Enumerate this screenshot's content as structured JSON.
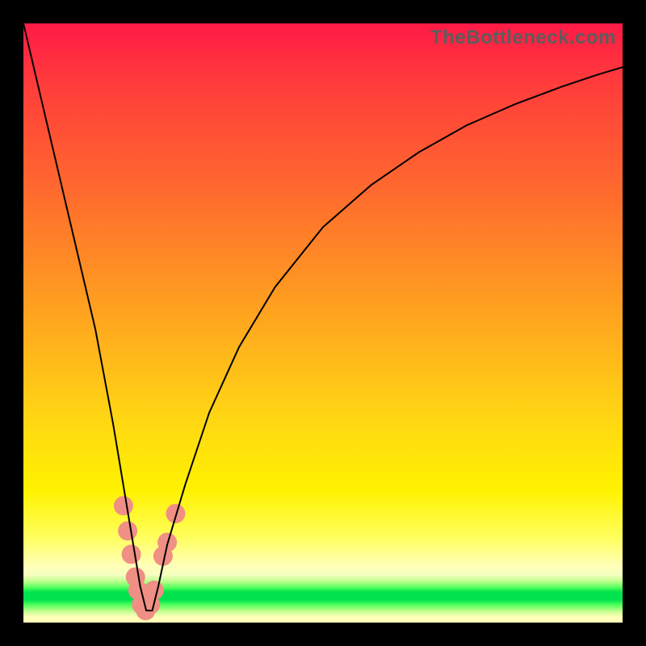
{
  "watermark": "TheBottleneck.com",
  "chart_data": {
    "type": "line",
    "title": "",
    "xlabel": "",
    "ylabel": "",
    "xlim": [
      0,
      100
    ],
    "ylim": [
      0,
      100
    ],
    "grid": false,
    "series": [
      {
        "name": "bottleneck-curve",
        "x": [
          0,
          4,
          8,
          12,
          15,
          17,
          18.5,
          19.5,
          20.5,
          21.5,
          22.5,
          24,
          27,
          31,
          36,
          42,
          50,
          58,
          66,
          74,
          82,
          90,
          96,
          100
        ],
        "values": [
          100,
          83,
          66,
          49,
          33,
          21,
          12,
          6,
          2,
          2,
          6,
          13,
          23,
          35,
          46,
          56,
          66,
          73,
          78.5,
          83,
          86.5,
          89.5,
          91.5,
          92.7
        ]
      }
    ],
    "markers": {
      "name": "highlight-points",
      "color": "#f08f84",
      "radius_px": 12,
      "points": [
        {
          "x": 16.7,
          "y": 19.5
        },
        {
          "x": 17.4,
          "y": 15.3
        },
        {
          "x": 18.0,
          "y": 11.4
        },
        {
          "x": 18.7,
          "y": 7.6
        },
        {
          "x": 19.1,
          "y": 5.4
        },
        {
          "x": 19.7,
          "y": 3.0
        },
        {
          "x": 20.4,
          "y": 2.0
        },
        {
          "x": 21.2,
          "y": 3.0
        },
        {
          "x": 21.8,
          "y": 5.4
        },
        {
          "x": 23.3,
          "y": 11.1
        },
        {
          "x": 24.0,
          "y": 13.4
        },
        {
          "x": 25.4,
          "y": 18.2
        }
      ]
    },
    "background_gradient": {
      "stops": [
        {
          "pos": 0.0,
          "color": "#ff1a46"
        },
        {
          "pos": 0.28,
          "color": "#ff6a2e"
        },
        {
          "pos": 0.65,
          "color": "#ffd414"
        },
        {
          "pos": 0.86,
          "color": "#ffff61"
        },
        {
          "pos": 0.95,
          "color": "#00e24e"
        },
        {
          "pos": 1.0,
          "color": "#ffffb8"
        }
      ]
    }
  }
}
